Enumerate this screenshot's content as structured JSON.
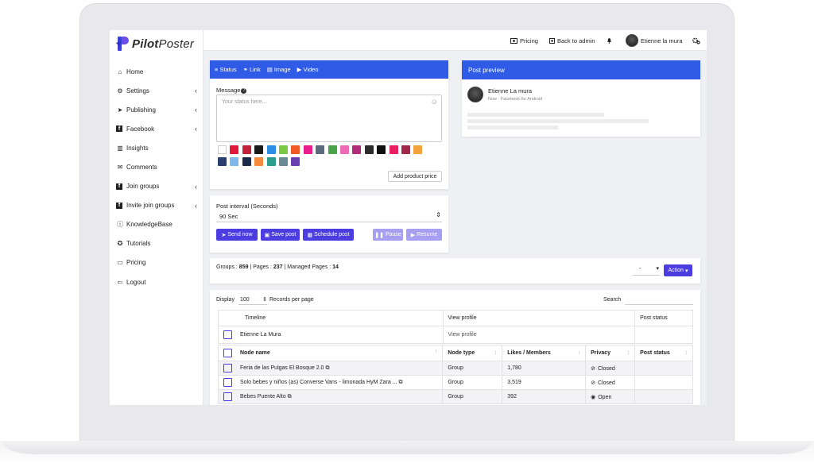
{
  "brand": {
    "name_part1": "Pilot",
    "name_part2": "Poster",
    "colors": {
      "primary": "#2f5be7",
      "button": "#4b3de0",
      "button_light": "#a79ff0"
    }
  },
  "topbar": {
    "pricing_label": "Pricing",
    "back_label": "Back to admin",
    "user_name": "Etienne la mura"
  },
  "sidebar": {
    "items": [
      {
        "label": "Home",
        "icon": "home-icon",
        "has_submenu": false
      },
      {
        "label": "Settings",
        "icon": "gear-icon",
        "has_submenu": true
      },
      {
        "label": "Publishing",
        "icon": "paper-plane-icon",
        "has_submenu": true
      },
      {
        "label": "Facebook",
        "icon": "facebook-icon",
        "has_submenu": true
      },
      {
        "label": "Insights",
        "icon": "chart-icon",
        "has_submenu": false
      },
      {
        "label": "Comments",
        "icon": "comments-icon",
        "has_submenu": false
      },
      {
        "label": "Join groups",
        "icon": "facebook-icon",
        "has_submenu": true
      },
      {
        "label": "Invite join groups",
        "icon": "facebook-icon",
        "has_submenu": true
      },
      {
        "label": "KnowledgeBase",
        "icon": "info-icon",
        "has_submenu": false
      },
      {
        "label": "Tutorials",
        "icon": "lifebuoy-icon",
        "has_submenu": false
      },
      {
        "label": "Pricing",
        "icon": "money-icon",
        "has_submenu": false
      },
      {
        "label": "Logout",
        "icon": "logout-icon",
        "has_submenu": false
      }
    ]
  },
  "composer": {
    "tabs": [
      "Status",
      "Link",
      "Image",
      "Video"
    ],
    "message_label": "Message",
    "message_placeholder": "Your status here...",
    "swatch_colors": [
      "#ffffff",
      "#e0173a",
      "#c3243c",
      "#1a1a1a",
      "#2b8fe6",
      "#7ac943",
      "#f05a24",
      "#e91e8c",
      "#5c6a80",
      "#49a34b",
      "#ec6bb4",
      "#b12c7b",
      "#2c2c2c",
      "#101010",
      "#e91e63",
      "#a0284a",
      "#f3a33a",
      "#2c3e70",
      "#7fb7ea",
      "#1b2a4a",
      "#f48c3c",
      "#2a9d8f",
      "#6c8a94",
      "#6a3fb0"
    ],
    "add_price_label": "Add product price",
    "interval_label": "Post interval (Seconds)",
    "interval_value": "90 Sec",
    "send_now": "Send now",
    "save_post": "Save post",
    "schedule_post": "Schedule post",
    "pause": "Pause",
    "resume": "Resume"
  },
  "preview": {
    "title": "Post preview",
    "author": "Etienne La mura",
    "meta": "Now · Facebook for Android"
  },
  "stats": {
    "groups_label": "Groups : ",
    "groups_value": "859",
    "pages_label": " | Pages : ",
    "pages_value": "237",
    "managed_label": " | Managed Pages : ",
    "managed_value": "14",
    "select_value": "-",
    "action_label": "Action"
  },
  "table": {
    "display_label": "Display",
    "display_value": "100",
    "records_label": "Records per page",
    "search_label": "Search",
    "timeline_header": [
      "Timeline",
      "View profile",
      "Post status"
    ],
    "timeline_row": {
      "name": "Etienne La Mura",
      "link": "View profile"
    },
    "columns": [
      "Node name",
      "Node type",
      "Likes / Members",
      "Privacy",
      "Post status"
    ],
    "rows": [
      {
        "name": "Feria de las Pulgas El Bosque 2.0",
        "type": "Group",
        "members": "1,780",
        "privacy": "Closed",
        "privacy_icon": "eye-slash-icon"
      },
      {
        "name": "Solo bebes y niños (as) Converse Vans - limonada HyM Zara ...",
        "type": "Group",
        "members": "3,519",
        "privacy": "Closed",
        "privacy_icon": "eye-slash-icon"
      },
      {
        "name": "Bebes Puente Alto",
        "type": "Group",
        "members": "392",
        "privacy": "Open",
        "privacy_icon": "eye-icon"
      }
    ]
  }
}
